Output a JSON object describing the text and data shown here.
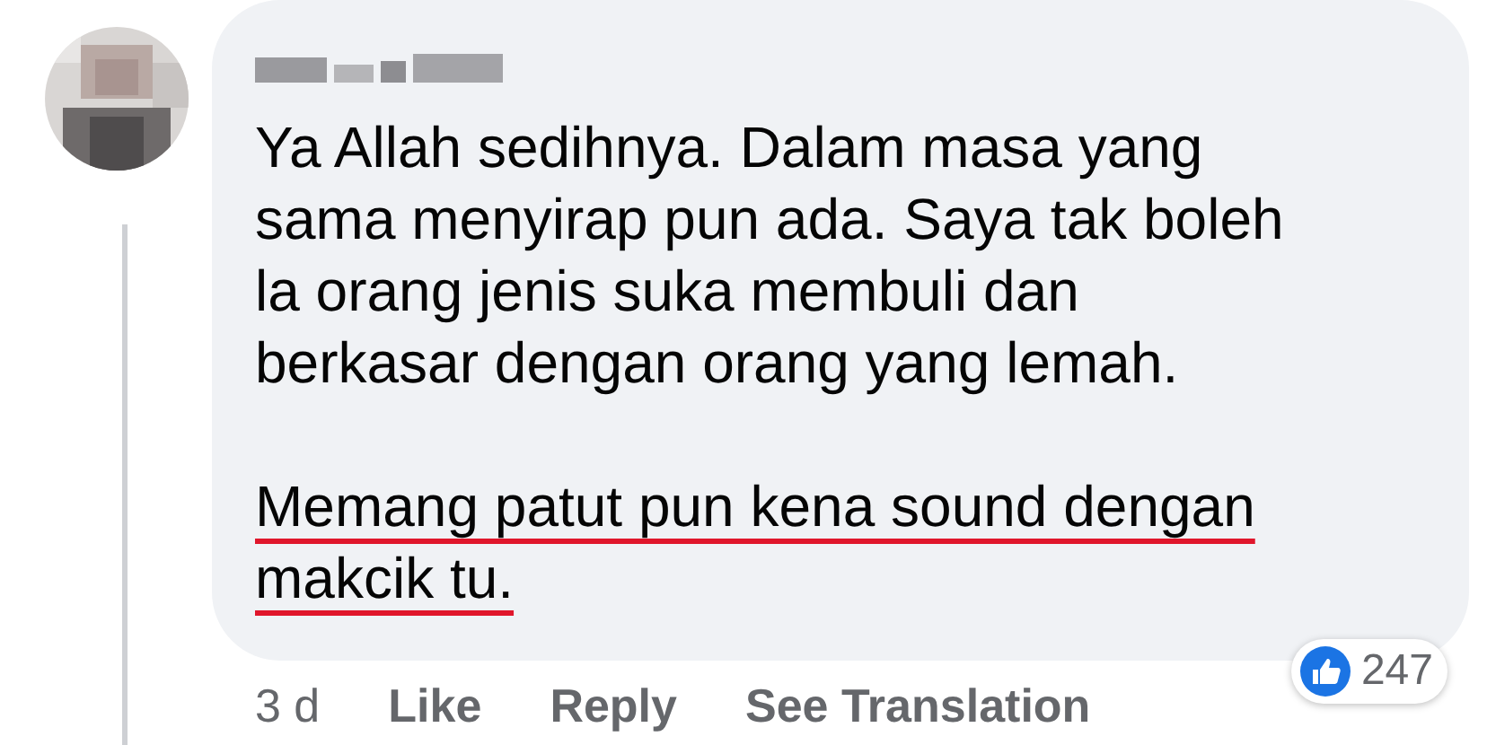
{
  "comment": {
    "paragraphs": [
      {
        "lines": [
          "Ya Allah sedihnya. Dalam masa yang",
          "sama menyirap pun ada. Saya tak boleh",
          "la orang jenis suka membuli dan",
          "berkasar dengan orang yang lemah."
        ],
        "underlined": false
      },
      {
        "lines": [
          "Memang patut pun kena sound dengan",
          "makcik tu."
        ],
        "underlined": true
      }
    ],
    "time": "3 d",
    "actions": [
      "Like",
      "Reply",
      "See Translation"
    ],
    "reaction_count": "247"
  }
}
